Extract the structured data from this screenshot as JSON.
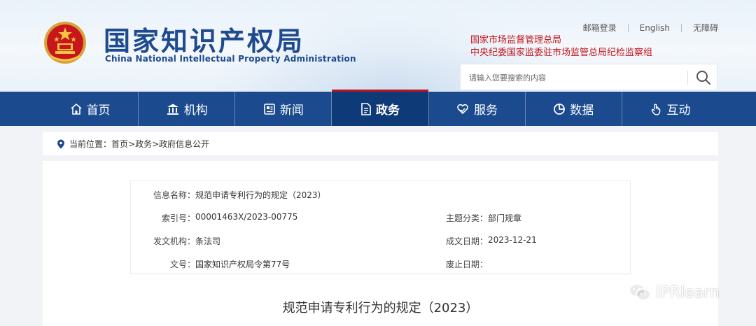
{
  "header": {
    "logo_cn": "国家知识产权局",
    "logo_en": "China National Intellectual Property Administration",
    "links": [
      "邮箱登录",
      "English",
      "无障碍"
    ],
    "org_line1": "国家市场监督管理总局",
    "org_line2": "中央纪委国家监委驻市场监管总局纪检监察组",
    "search_placeholder": "请输入您要搜索的内容"
  },
  "nav": {
    "items": [
      {
        "label": "首页",
        "icon": "home-icon"
      },
      {
        "label": "机构",
        "icon": "institution-icon"
      },
      {
        "label": "新闻",
        "icon": "newspaper-icon"
      },
      {
        "label": "政务",
        "icon": "document-icon",
        "active": true
      },
      {
        "label": "服务",
        "icon": "heart-hand-icon"
      },
      {
        "label": "数据",
        "icon": "pie-chart-icon"
      },
      {
        "label": "互动",
        "icon": "tap-icon"
      }
    ]
  },
  "breadcrumb": {
    "prefix": "当前位置：",
    "path": "首页>政务>政府信息公开"
  },
  "info": {
    "name_label": "信息名称：",
    "name_value": "规范申请专利行为的规定（2023）",
    "index_label": "索引号：",
    "index_value": "00001463X/2023-00775",
    "topic_label": "主题分类：",
    "topic_value": "部门规章",
    "issuer_label": "发文机构：",
    "issuer_value": "条法司",
    "date_label": "成文日期：",
    "date_value": "2023-12-21",
    "docno_label": "文号：",
    "docno_value": "国家知识产权局令第77号",
    "expire_label": "废止日期：",
    "expire_value": ""
  },
  "document": {
    "title": "规范申请专利行为的规定（2023）"
  },
  "watermark": "IPRlearn",
  "colors": {
    "nav_bg": "#1b4a8e",
    "nav_active_bg": "#0f3a78",
    "brand_blue": "#1e4a8f",
    "accent_red": "#c0141c"
  }
}
